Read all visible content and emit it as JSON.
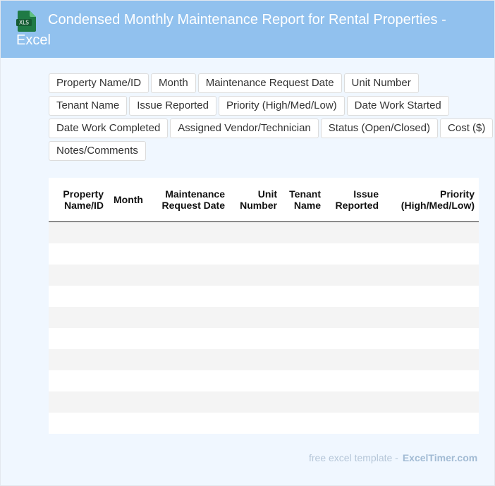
{
  "header": {
    "icon_label": "XLS",
    "title": "Condensed Monthly Maintenance Report for Rental Properties - Excel"
  },
  "fields": [
    "Property Name/ID",
    "Month",
    "Maintenance Request Date",
    "Unit Number",
    "Tenant Name",
    "Issue Reported",
    "Priority (High/Med/Low)",
    "Date Work Started",
    "Date Work Completed",
    "Assigned Vendor/Technician",
    "Status (Open/Closed)",
    "Cost ($)",
    "Notes/Comments"
  ],
  "table": {
    "columns": [
      [
        "Property",
        "Name/ID"
      ],
      [
        "Month"
      ],
      [
        "Maintenance",
        "Request Date"
      ],
      [
        "Unit",
        "Number"
      ],
      [
        "Tenant",
        "Name"
      ],
      [
        "Issue",
        "Reported"
      ],
      [
        "Priority",
        "(High/Med/Low)"
      ]
    ],
    "row_count": 10
  },
  "footer": {
    "text": "free excel template -",
    "brand": "ExcelTimer.com"
  },
  "colors": {
    "header_bg": "#91c1ee",
    "page_bg": "#f0f7ff",
    "icon_green": "#1f7a45"
  }
}
